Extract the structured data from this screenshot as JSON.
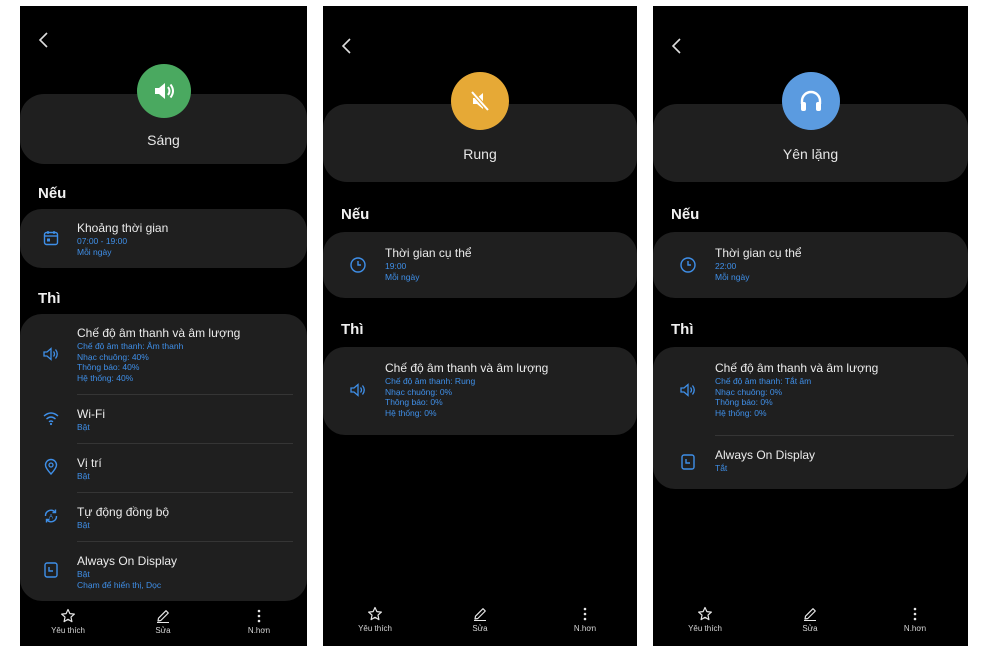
{
  "colors": {
    "screen_bg": "#000000",
    "card_bg": "#1f1f1f",
    "accent": "#3f8fe8",
    "sound_green": "#4aa960",
    "vibrate_orange": "#e6a936",
    "silent_blue": "#5b9be0"
  },
  "screens": [
    {
      "mode_icon": "speaker-icon",
      "mode_name": "Sáng",
      "if_label": "Nếu",
      "if_rows": [
        {
          "icon": "calendar-icon",
          "title": "Khoảng thời gian",
          "subs": [
            "07:00 - 19:00",
            "Mỗi ngày"
          ]
        }
      ],
      "then_label": "Thì",
      "then_rows": [
        {
          "icon": "volume-icon",
          "title": "Chế độ âm thanh và âm lượng",
          "subs": [
            "Chế độ âm thanh: Âm thanh",
            "Nhạc chuông: 40%",
            "Thông báo: 40%",
            "Hệ thống: 40%"
          ]
        },
        {
          "icon": "wifi-icon",
          "title": "Wi-Fi",
          "subs": [
            "Bật"
          ]
        },
        {
          "icon": "location-icon",
          "title": "Vị trí",
          "subs": [
            "Bật"
          ]
        },
        {
          "icon": "sync-icon",
          "title": "Tự động đồng bộ",
          "subs": [
            "Bật"
          ]
        },
        {
          "icon": "aod-icon",
          "title": "Always On Display",
          "subs": [
            "Bật",
            "Chạm để hiển thị, Dọc"
          ]
        }
      ],
      "nav": [
        "Yêu thích",
        "Sửa",
        "N.hơn"
      ]
    },
    {
      "mode_icon": "vibrate-icon",
      "mode_name": "Rung",
      "if_label": "Nếu",
      "if_rows": [
        {
          "icon": "clock-icon",
          "title": "Thời gian cụ thể",
          "subs": [
            "19:00",
            "Mỗi ngày"
          ]
        }
      ],
      "then_label": "Thì",
      "then_rows": [
        {
          "icon": "volume-icon",
          "title": "Chế độ âm thanh và âm lượng",
          "subs": [
            "Chế độ âm thanh: Rung",
            "Nhạc chuông: 0%",
            "Thông báo: 0%",
            "Hệ thống: 0%"
          ]
        }
      ],
      "nav": [
        "Yêu thích",
        "Sửa",
        "N.hơn"
      ]
    },
    {
      "mode_icon": "headphones-icon",
      "mode_name": "Yên lặng",
      "if_label": "Nếu",
      "if_rows": [
        {
          "icon": "clock-icon",
          "title": "Thời gian cụ thể",
          "subs": [
            "22:00",
            "Mỗi ngày"
          ]
        }
      ],
      "then_label": "Thì",
      "then_rows": [
        {
          "icon": "volume-icon",
          "title": "Chế độ âm thanh và âm lượng",
          "subs": [
            "Chế độ âm thanh: Tắt âm",
            "Nhạc chuông: 0%",
            "Thông báo: 0%",
            "Hệ thống: 0%"
          ]
        },
        {
          "icon": "aod-icon",
          "title": "Always On Display",
          "subs": [
            "Tắt"
          ]
        }
      ],
      "nav": [
        "Yêu thích",
        "Sửa",
        "N.hơn"
      ]
    }
  ]
}
